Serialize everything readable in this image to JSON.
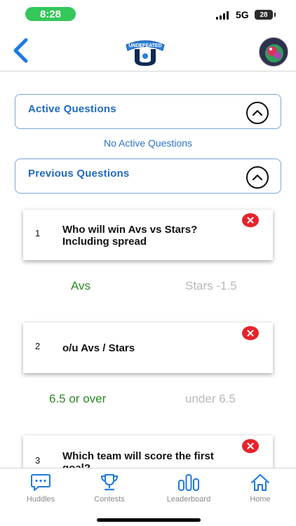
{
  "status_bar": {
    "time": "8:28",
    "network": "5G",
    "battery": "28"
  },
  "header": {
    "back_icon": "chevron-left-icon",
    "logo": {
      "icon": "undefeated-logo",
      "text": "UNDEFEATED"
    },
    "avatar_icon": "user-avatar",
    "accent_color": "#1f6ac1"
  },
  "sections": {
    "active": {
      "title": "Active Questions",
      "toggle_icon": "chevron-up-icon",
      "empty_text": "No Active Questions"
    },
    "previous": {
      "title": "Previous Questions",
      "toggle_icon": "chevron-up-icon"
    }
  },
  "questions": [
    {
      "number": "1",
      "text": "Who will win Avs vs Stars? Including spread",
      "answers": [
        "Avs",
        "Stars -1.5"
      ],
      "selected_index": 0
    },
    {
      "number": "2",
      "text": "o/u Avs / Stars",
      "answers": [
        "6.5 or over",
        "under 6.5"
      ],
      "selected_index": 0
    },
    {
      "number": "3",
      "text": "Which team will score the first goal?",
      "answers": [],
      "selected_index": null
    }
  ],
  "colors": {
    "selected_answer": "#2a8a23",
    "unselected_answer": "#b8b8b8",
    "delete": "#e8232a"
  },
  "tab_bar": [
    {
      "label": "Huddles",
      "icon": "chat-bubble-icon"
    },
    {
      "label": "Contests",
      "icon": "trophy-icon"
    },
    {
      "label": "Leaderboard",
      "icon": "bar-chart-icon"
    },
    {
      "label": "Home",
      "icon": "home-icon"
    }
  ]
}
